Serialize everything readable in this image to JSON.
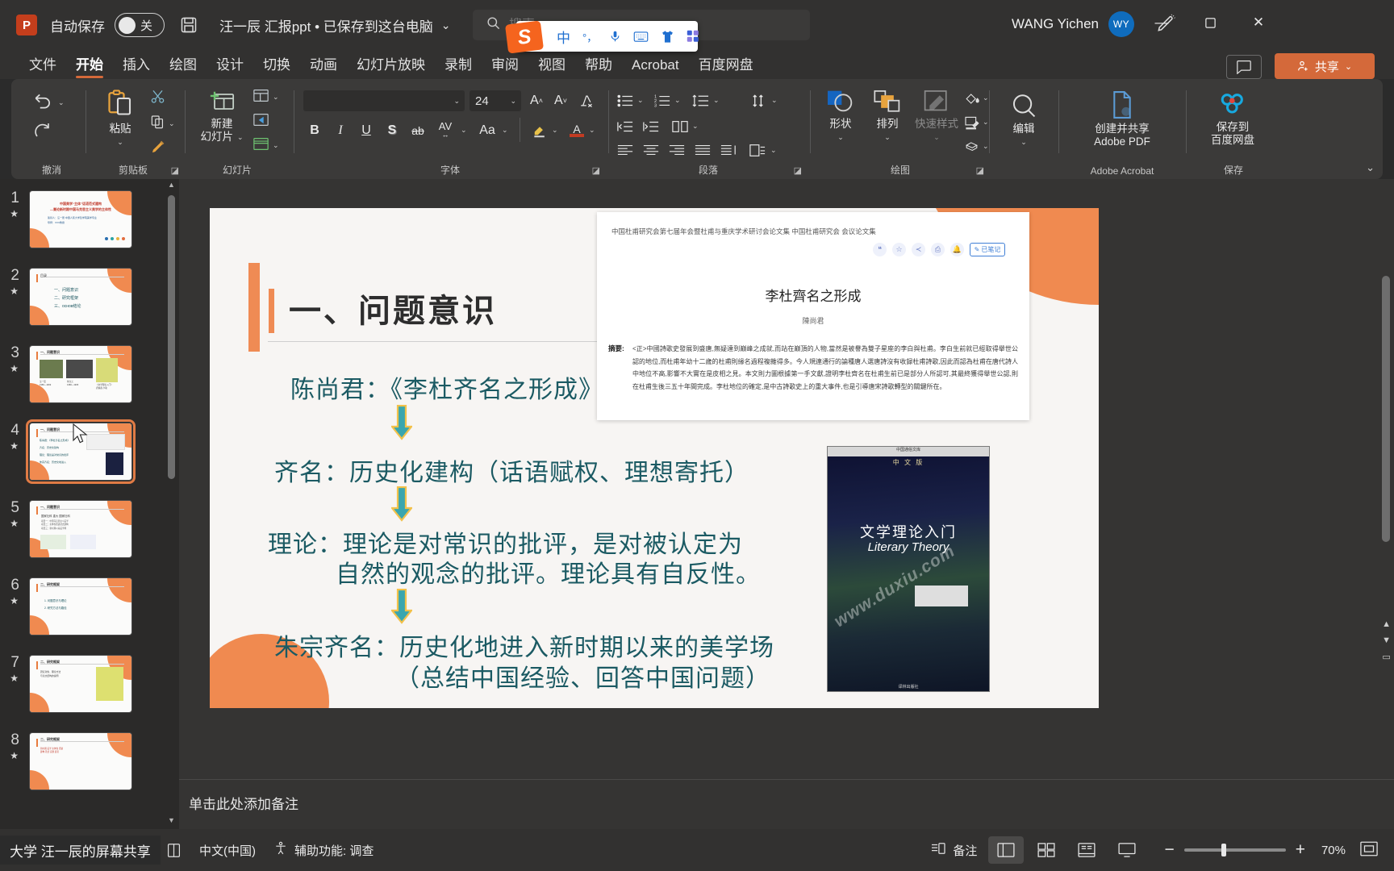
{
  "titlebar": {
    "app_icon": "powerpoint-logo-icon",
    "autosave_label": "自动保存",
    "autosave_state": "关",
    "save_icon": "save-disk-icon",
    "filename": "汪一辰 汇报ppt • 已保存到这台电脑",
    "filename_chevron": "⌄",
    "search_placeholder": "搜索",
    "search_icon": "search-icon",
    "user_name": "WANG Yichen",
    "user_initials": "WY",
    "pen_icon": "pen-draw-icon",
    "minimize": "—",
    "maximize": "▢",
    "close": "✕"
  },
  "ime": {
    "logo": "S",
    "mode": "中",
    "punct": "°，",
    "mic_icon": "microphone-icon",
    "keyboard_icon": "keyboard-icon",
    "skin_icon": "tshirt-skin-icon",
    "apps_icon": "toolbox-apps-icon"
  },
  "tabs": [
    {
      "label": "文件",
      "active": false
    },
    {
      "label": "开始",
      "active": true
    },
    {
      "label": "插入",
      "active": false
    },
    {
      "label": "绘图",
      "active": false
    },
    {
      "label": "设计",
      "active": false
    },
    {
      "label": "切换",
      "active": false
    },
    {
      "label": "动画",
      "active": false
    },
    {
      "label": "幻灯片放映",
      "active": false
    },
    {
      "label": "录制",
      "active": false
    },
    {
      "label": "审阅",
      "active": false
    },
    {
      "label": "视图",
      "active": false
    },
    {
      "label": "帮助",
      "active": false
    },
    {
      "label": "Acrobat",
      "active": false
    },
    {
      "label": "百度网盘",
      "active": false
    }
  ],
  "tabbar_right": {
    "comment_icon": "comment-icon",
    "share_label": "共享",
    "share_icon": "share-person-icon",
    "share_chevron": "⌄"
  },
  "ribbon": {
    "groups": [
      {
        "label": "撤消"
      },
      {
        "label": "剪贴板"
      },
      {
        "label": "幻灯片"
      },
      {
        "label": "字体"
      },
      {
        "label": "段落"
      },
      {
        "label": "绘图"
      },
      {
        "label": "Adobe Acrobat"
      },
      {
        "label": "保存"
      }
    ],
    "undo": {
      "icon": "undo-arrow-icon",
      "chevron": "⌄"
    },
    "redo": {
      "icon": "redo-arrow-icon"
    },
    "paste": {
      "label": "粘贴",
      "icon": "clipboard-paste-icon",
      "chevron": "⌄"
    },
    "cut": {
      "icon": "scissors-icon"
    },
    "copy": {
      "icon": "copy-icon",
      "chevron": "⌄"
    },
    "format_painter": {
      "icon": "format-painter-brush-icon"
    },
    "new_slide": {
      "label": "新建\n幻灯片",
      "label_l1": "新建",
      "label_l2": "幻灯片",
      "icon": "new-slide-icon",
      "chevron": "⌄"
    },
    "layout": {
      "icon": "slide-layout-icon",
      "chevron": "⌄"
    },
    "reset": {
      "icon": "reset-slide-icon"
    },
    "section": {
      "icon": "section-icon",
      "chevron": "⌄"
    },
    "font_name": {
      "value": "",
      "chevron": "⌄"
    },
    "font_size": {
      "value": "24",
      "chevron": "⌄"
    },
    "grow_font": {
      "icon": "increase-font-size-icon",
      "glyph": "A"
    },
    "shrink_font": {
      "icon": "decrease-font-size-icon",
      "glyph": "A"
    },
    "clear_format": {
      "icon": "clear-formatting-icon",
      "glyph": "A"
    },
    "bold": {
      "glyph": "B",
      "icon": "bold-icon"
    },
    "italic": {
      "glyph": "I",
      "icon": "italic-icon"
    },
    "underline": {
      "glyph": "U",
      "icon": "underline-icon"
    },
    "shadow": {
      "glyph": "S",
      "icon": "text-shadow-icon"
    },
    "strike": {
      "glyph": "ab",
      "icon": "strikethrough-icon"
    },
    "char_spacing": {
      "glyph": "AV",
      "icon": "character-spacing-icon",
      "chevron": "⌄"
    },
    "change_case": {
      "glyph": "Aa",
      "icon": "change-case-icon",
      "chevron": "⌄"
    },
    "highlight": {
      "icon": "text-highlight-icon",
      "chevron": "⌄"
    },
    "font_color": {
      "icon": "font-color-icon",
      "glyph": "A",
      "chevron": "⌄"
    },
    "bullets": {
      "icon": "bullet-list-icon",
      "chevron": "⌄"
    },
    "numbering": {
      "icon": "numbered-list-icon",
      "chevron": "⌄"
    },
    "line_spacing": {
      "icon": "line-spacing-icon",
      "chevron": "⌄"
    },
    "text_direction": {
      "icon": "text-direction-icon",
      "chevron": "⌄"
    },
    "dec_indent": {
      "icon": "decrease-indent-icon"
    },
    "inc_indent": {
      "icon": "increase-indent-icon"
    },
    "columns": {
      "icon": "columns-icon",
      "chevron": "⌄"
    },
    "align_left": {
      "icon": "align-left-icon"
    },
    "align_center": {
      "icon": "align-center-icon"
    },
    "align_right": {
      "icon": "align-right-icon"
    },
    "justify": {
      "icon": "justify-icon"
    },
    "align_text": {
      "icon": "align-text-vertical-icon"
    },
    "smartart": {
      "icon": "convert-smartart-icon",
      "chevron": "⌄"
    },
    "shapes": {
      "label": "形状",
      "icon": "shapes-icon",
      "chevron": "⌄"
    },
    "arrange": {
      "label": "排列",
      "icon": "arrange-icon",
      "chevron": "⌄"
    },
    "quick_styles": {
      "label": "快速样式",
      "icon": "quick-styles-icon",
      "chevron": "⌄",
      "disabled": true
    },
    "shape_fill": {
      "icon": "shape-fill-icon",
      "chevron": "⌄"
    },
    "shape_outline": {
      "icon": "shape-outline-icon",
      "chevron": "⌄"
    },
    "shape_effects": {
      "icon": "shape-effects-icon",
      "chevron": "⌄"
    },
    "editing": {
      "label": "编辑",
      "icon": "search-editing-icon",
      "chevron": "⌄"
    },
    "create_pdf": {
      "label_l1": "创建并共享",
      "label_l2": "Adobe PDF",
      "icon": "adobe-pdf-icon"
    },
    "baidu_save": {
      "label_l1": "保存到",
      "label_l2": "百度网盘",
      "icon": "baidu-netdisk-icon"
    },
    "collapse_ribbon": {
      "icon": "collapse-ribbon-chevron-icon",
      "glyph": "⌄"
    }
  },
  "thumbnails": [
    {
      "number": "1",
      "star": "★",
      "selected": false
    },
    {
      "number": "2",
      "star": "★",
      "selected": false
    },
    {
      "number": "3",
      "star": "★",
      "selected": false
    },
    {
      "number": "4",
      "star": "★",
      "selected": true
    },
    {
      "number": "5",
      "star": "★",
      "selected": false
    },
    {
      "number": "6",
      "star": "★",
      "selected": false
    },
    {
      "number": "7",
      "star": "★",
      "selected": false
    },
    {
      "number": "8",
      "star": "★",
      "selected": false
    }
  ],
  "slide": {
    "title": "一、问题意识",
    "lines": [
      {
        "text": "陈尚君：《李杜齐名之形成》"
      },
      {
        "text": "齐名：历史化建构（话语赋权、理想寄托）"
      },
      {
        "text": "理论：理论是对常识的批评，是对被认定为"
      },
      {
        "text": "自然的观念的批评。理论具有自反性。"
      },
      {
        "text": "朱宗齐名：历史化地进入新时期以来的美学场"
      },
      {
        "text": "（总结中国经验、回答中国问题）"
      }
    ],
    "arrow_icon": "down-arrow-icon",
    "picture": {
      "header": "中国杜甫研究会第七届年会暨杜甫与重庆学术研讨会论文集 中国杜甫研究会 会议论文集",
      "title": "李杜齊名之形成",
      "author": "陳尚君",
      "abstract_label": "摘要:",
      "abstract": "<正>中國詩歌史發展到盛唐,無疑達到巔峰之成就,而站在巔頂的人物,當然是被譽為雙子星座的李白與杜甫。李白生前就已經取得舉世公認的地位,而杜甫年幼十二歲的杜甫則緣名過程複雜得多。今人規連通行的論種唐人選唐詩沒有收録杜甫詩歌,因此而認為杜甫在唐代詩人中地位不高,影響不大實在是皮相之見。本文則力圖根據第一手文獻,證明李杜齊名在杜甫生前已是部分人所認可,其最終獲得舉世公認,則在杜甫生後三五十年間完成。李杜地位的確定,是中古詩歌史上的重大事件,也是引導唐宋詩歌轉型的關鍵所在。",
      "icons": [
        "quote-icon",
        "favorite-star-icon",
        "share-icon",
        "print-icon",
        "bell-icon"
      ],
      "note_button": "已笔记"
    },
    "book": {
      "top_band": "中国通俗文库",
      "cn_title": "中 文 版",
      "title_cn": "文学理论入门",
      "title_en": "Literary Theory",
      "watermark": "www.duxiu.com",
      "publisher": "译林出版社"
    }
  },
  "notes": {
    "placeholder": "单击此处添加备注"
  },
  "statusbar": {
    "share_tip": "大学 汪一辰的屏幕共享",
    "notes_page_icon": "notes-page-icon",
    "language": "中文(中国)",
    "accessibility_icon": "accessibility-icon",
    "accessibility": "辅助功能: 调查",
    "notes_label": "备注",
    "notes_icon": "notes-icon",
    "view_normal_icon": "normal-view-icon",
    "view_sorter_icon": "slide-sorter-icon",
    "view_reading_icon": "reading-view-icon",
    "view_show_icon": "slideshow-view-icon",
    "zoom_out": "−",
    "zoom_in": "+",
    "zoom_level": "70%",
    "fit_icon": "fit-to-window-icon"
  },
  "colors": {
    "accent_orange": "#d4693a",
    "slide_orange": "#f08a50",
    "slide_text_teal": "#1b5a63",
    "arrow_teal": "#3aa6ae",
    "arrow_outline": "#f2c14a",
    "avatar_blue": "#0f6cbd"
  }
}
